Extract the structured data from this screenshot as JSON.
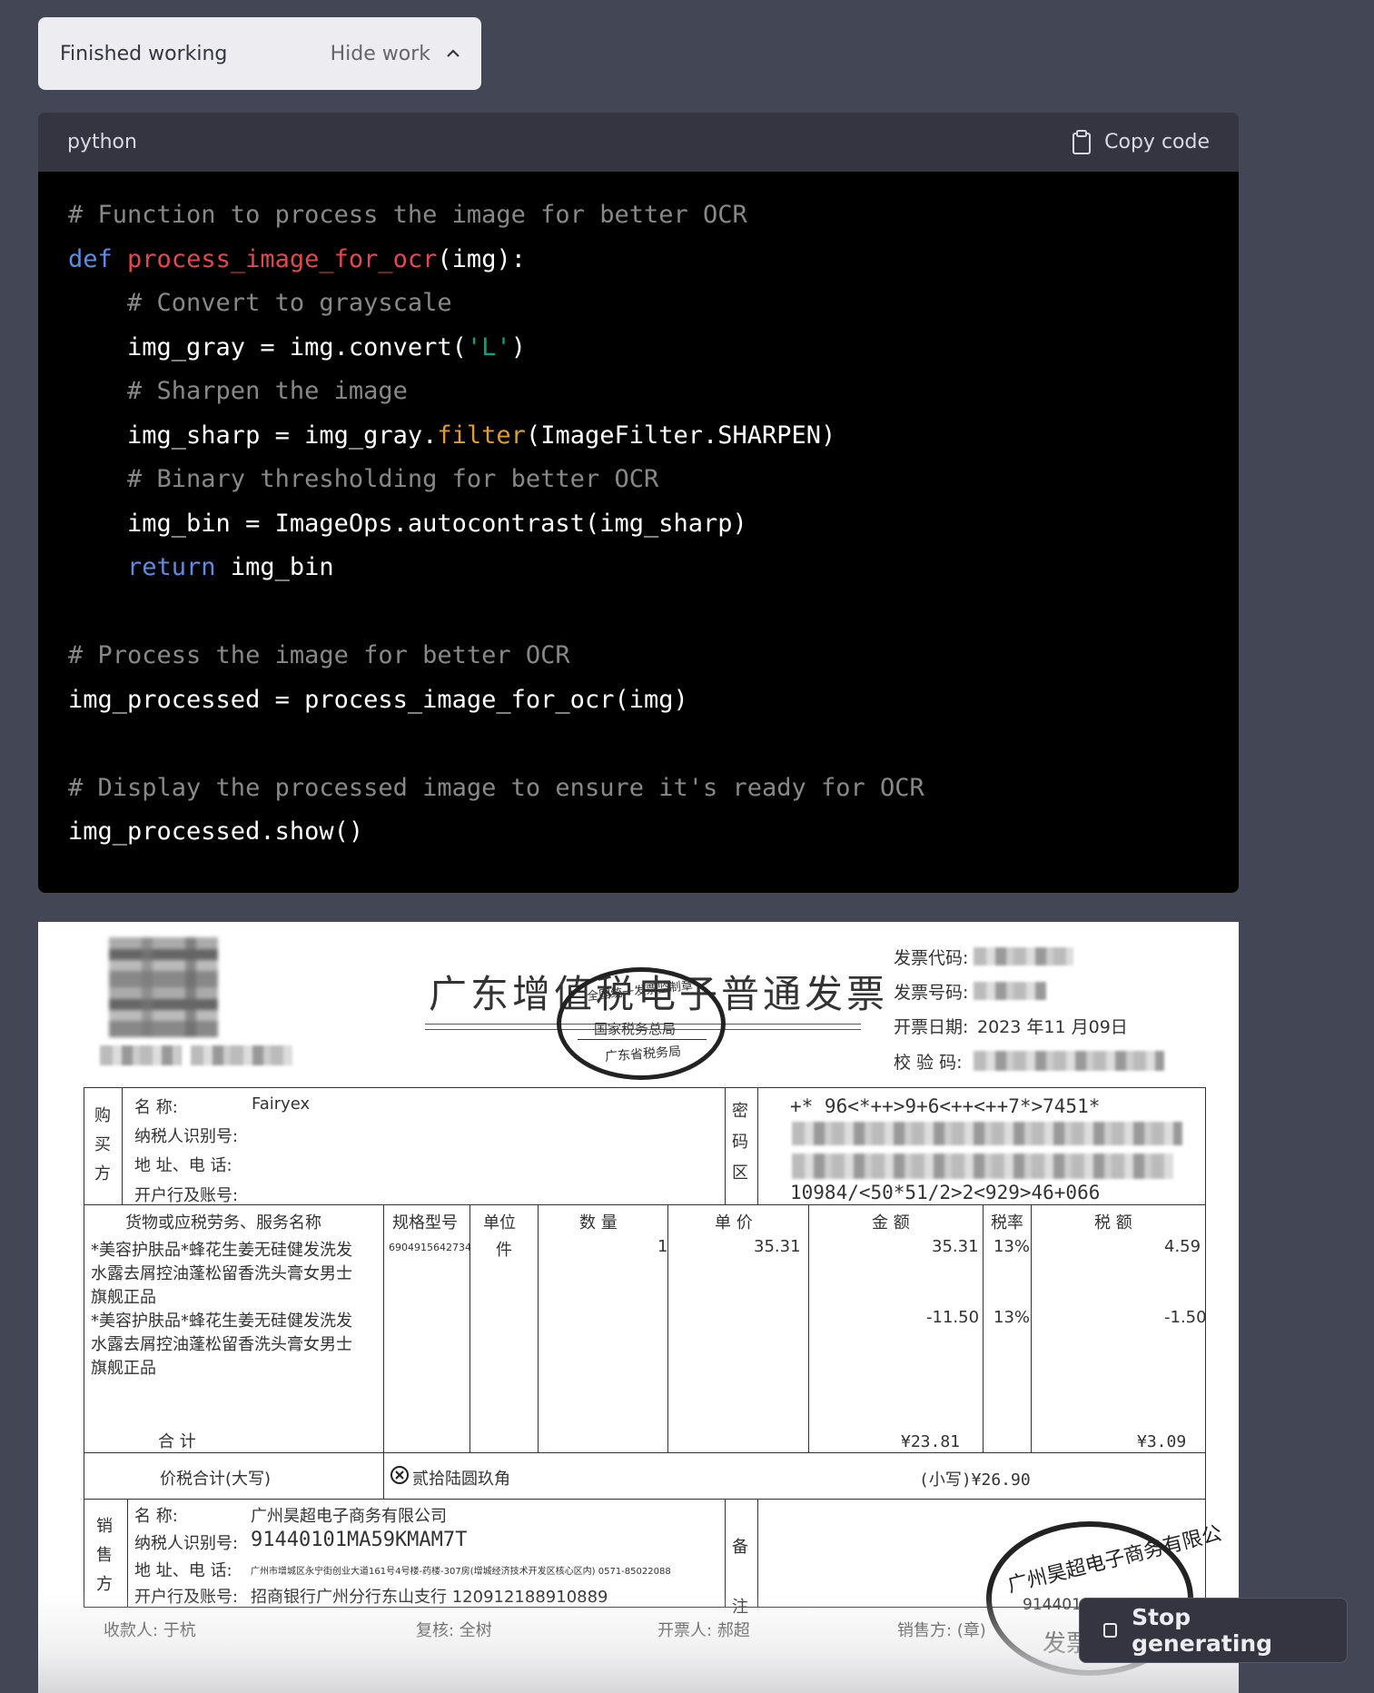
{
  "status": {
    "label": "Finished working",
    "toggle_label": "Hide work"
  },
  "code_block": {
    "language": "python",
    "copy_label": "Copy code",
    "lines": [
      "# Function to process the image for better OCR",
      "def process_image_for_ocr(img):",
      "    # Convert to grayscale",
      "    img_gray = img.convert('L')",
      "    # Sharpen the image",
      "    img_sharp = img_gray.filter(ImageFilter.SHARPEN)",
      "    # Binary thresholding for better OCR",
      "    img_bin = ImageOps.autocontrast(img_sharp)",
      "    return img_bin",
      "",
      "# Process the image for better OCR",
      "img_processed = process_image_for_ocr(img)",
      "",
      "# Display the processed image to ensure it's ready for OCR",
      "img_processed.show()"
    ]
  },
  "invoice": {
    "title": "广东增值税电子普通发票",
    "code_label": "发票代码:",
    "number_label": "发票号码:",
    "date_label": "开票日期:",
    "date_value": "2023 年11 月09日",
    "check_label": "校 验 码:",
    "stamp_top": "全国统一发票监制章",
    "stamp_mid": "国家税务总局",
    "stamp_bottom": "广东省税务局",
    "buyer_side": "购买方",
    "buyer_name_label": "名 称:",
    "buyer_name": "Fairyex",
    "buyer_taxid_label": "纳税人识别号:",
    "buyer_address_label": "地 址、电 话:",
    "buyer_bank_label": "开户行及账号:",
    "cipher_side": "密码区",
    "cipher_line1": "+* 96<*++>9+6<++<++7*>7451*",
    "cipher_line4": "10984/<50*51/2>2<929>46+066",
    "headers": {
      "item": "货物或应税劳务、服务名称",
      "spec": "规格型号",
      "unit": "单位",
      "qty": "数 量",
      "price": "单 价",
      "amount": "金 额",
      "rate": "税率",
      "tax": "税 额"
    },
    "items": [
      {
        "name_l1": "*美容护肤品*蜂花生姜无硅健发洗发",
        "name_l2": "水露去屑控油蓬松留香洗头膏女男士",
        "name_l3": "旗舰正品",
        "spec": "6904915642734",
        "unit": "件",
        "qty": "1",
        "price": "35.31",
        "amount": "35.31",
        "rate": "13%",
        "tax": "4.59"
      },
      {
        "name_l1": "*美容护肤品*蜂花生姜无硅健发洗发",
        "name_l2": "水露去屑控油蓬松留香洗头膏女男士",
        "name_l3": "旗舰正品",
        "amount": "-11.50",
        "rate": "13%",
        "tax": "-1.50"
      }
    ],
    "total_label": "合 计",
    "total_amount": "¥23.81",
    "total_tax": "¥3.09",
    "grand_label": "价税合计(大写)",
    "grand_words": "贰拾陆圆玖角",
    "grand_small": "(小写)¥26.90",
    "seller_side": "销售方",
    "seller_name_label": "名 称:",
    "seller_name": "广州昊超电子商务有限公司",
    "seller_taxid_label": "纳税人识别号:",
    "seller_taxid": "91440101MA59KMAM7T",
    "seller_address_label": "地 址、电 话:",
    "seller_address": "广州市增城区永宁街创业大道161号4号楼-药楼-307房(增城经济技术开发区核心区内) 0571-85022088",
    "seller_bank_label": "开户行及账号:",
    "seller_bank": "招商银行广州分行东山支行 120912188910889",
    "remark_side": "备注",
    "seal_text": "广州昊超电子商务有限公",
    "seal_number": "91440101MA59KMAM7T",
    "seal_bottom": "发票",
    "payee": "收款人: 于杭",
    "reviewer": "复核: 全树",
    "issuer": "开票人: 郝超",
    "seller_sign": "销售方: (章)"
  },
  "stop_button": {
    "label": "Stop generating"
  }
}
